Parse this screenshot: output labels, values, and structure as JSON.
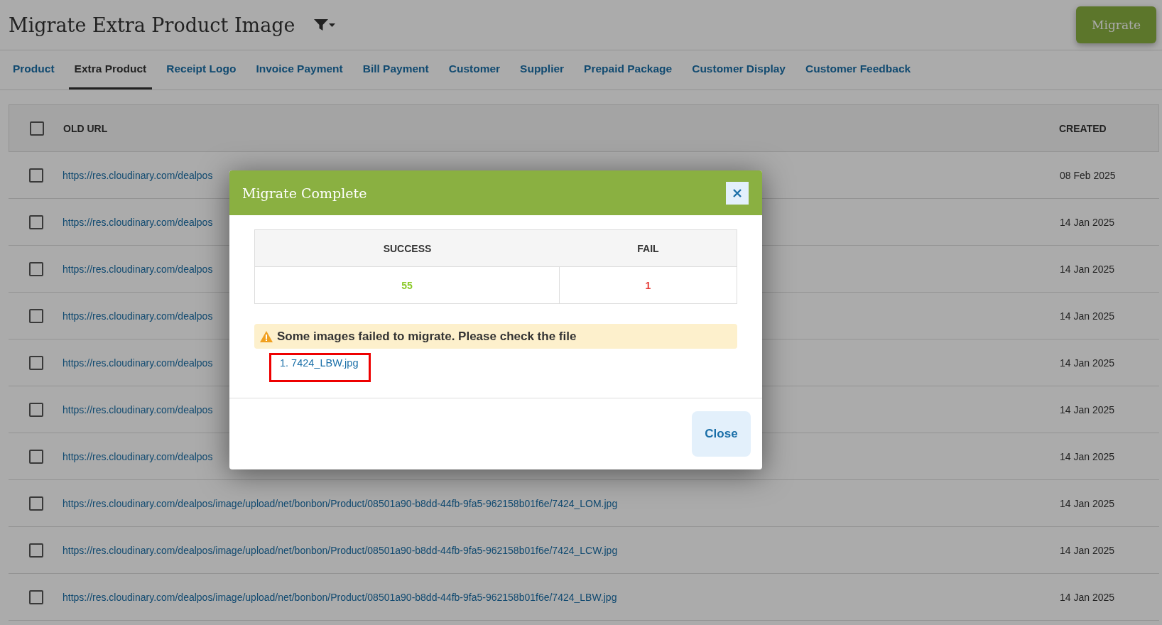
{
  "page": {
    "title": "Migrate Extra Product Image",
    "migrate_button": "Migrate"
  },
  "tabs": [
    {
      "label": "Product",
      "selected": false
    },
    {
      "label": "Extra Product",
      "selected": true
    },
    {
      "label": "Receipt Logo",
      "selected": false
    },
    {
      "label": "Invoice Payment",
      "selected": false
    },
    {
      "label": "Bill Payment",
      "selected": false
    },
    {
      "label": "Customer",
      "selected": false
    },
    {
      "label": "Supplier",
      "selected": false
    },
    {
      "label": "Prepaid Package",
      "selected": false
    },
    {
      "label": "Customer Display",
      "selected": false
    },
    {
      "label": "Customer Feedback",
      "selected": false
    }
  ],
  "table": {
    "columns": [
      "OLD URL",
      "CREATED"
    ],
    "all_checked": false,
    "rows": [
      {
        "url": "https://res.cloudinary.com/dealpos",
        "created": "08 Feb 2025",
        "checked": false
      },
      {
        "url": "https://res.cloudinary.com/dealpos",
        "created": "14 Jan 2025",
        "checked": false
      },
      {
        "url": "https://res.cloudinary.com/dealpos",
        "created": "14 Jan 2025",
        "checked": false
      },
      {
        "url": "https://res.cloudinary.com/dealpos",
        "created": "14 Jan 2025",
        "checked": false
      },
      {
        "url": "https://res.cloudinary.com/dealpos",
        "created": "14 Jan 2025",
        "checked": false
      },
      {
        "url": "https://res.cloudinary.com/dealpos",
        "created": "14 Jan 2025",
        "checked": false
      },
      {
        "url": "https://res.cloudinary.com/dealpos",
        "created": "14 Jan 2025",
        "checked": false
      },
      {
        "url": "https://res.cloudinary.com/dealpos/image/upload/net/bonbon/Product/08501a90-b8dd-44fb-9fa5-962158b01f6e/7424_LOM.jpg",
        "created": "14 Jan 2025",
        "checked": false
      },
      {
        "url": "https://res.cloudinary.com/dealpos/image/upload/net/bonbon/Product/08501a90-b8dd-44fb-9fa5-962158b01f6e/7424_LCW.jpg",
        "created": "14 Jan 2025",
        "checked": false
      },
      {
        "url": "https://res.cloudinary.com/dealpos/image/upload/net/bonbon/Product/08501a90-b8dd-44fb-9fa5-962158b01f6e/7424_LBW.jpg",
        "created": "14 Jan 2025",
        "checked": false
      }
    ]
  },
  "dialog": {
    "title": "Migrate Complete",
    "columns": [
      "SUCCESS",
      "FAIL"
    ],
    "success": "55",
    "fail": "1",
    "warning": "Some images failed to migrate. Please check the file",
    "failed_files": [
      "1. 7424_LBW.jpg"
    ],
    "close_button": "Close"
  }
}
